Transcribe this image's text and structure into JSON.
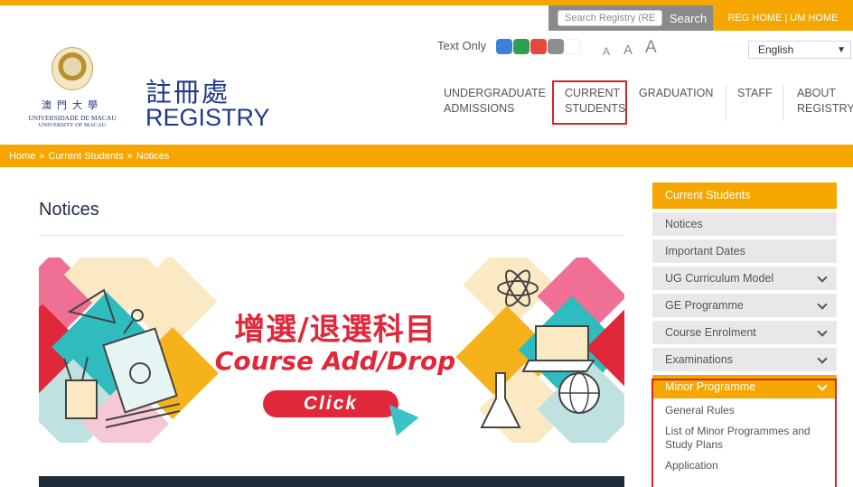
{
  "utility": {
    "search_placeholder": "Search Registry (REG)",
    "search_label": "Search",
    "reg_home": "REG HOME",
    "separator": "|",
    "um_home": "UM HOME"
  },
  "logo": {
    "university_cn": "澳門大學",
    "university_pt": "UNIVERSIDADE DE MACAU",
    "university_en": "UNIVERSITY OF MACAU"
  },
  "site": {
    "name_cn": "註冊處",
    "name_en": "REGISTRY"
  },
  "accessibility": {
    "text_only": "Text Only",
    "font_sizes": [
      "A",
      "A",
      "A"
    ],
    "swatch_colors": [
      "#3b82d6",
      "#2e9e4f",
      "#e8483b",
      "#8e8e8e",
      "#ffffff"
    ]
  },
  "language": {
    "selected": "English",
    "arrow": "▼"
  },
  "nav": {
    "items": [
      {
        "line1": "UNDERGRADUATE",
        "line2": "ADMISSIONS"
      },
      {
        "line1": "CURRENT",
        "line2": "STUDENTS"
      },
      {
        "line1": "GRADUATION",
        "line2": ""
      },
      {
        "line1": "STAFF",
        "line2": ""
      },
      {
        "line1": "ABOUT",
        "line2": "REGISTRY"
      }
    ]
  },
  "breadcrumb": {
    "home": "Home",
    "sep": "»",
    "section": "Current Students",
    "page": "Notices"
  },
  "main": {
    "title": "Notices",
    "banner": {
      "title_cn": "增選/退選科目",
      "title_en": "Course Add/Drop",
      "button": "Click"
    }
  },
  "sidebar": {
    "heading": "Current Students",
    "items": [
      {
        "label": "Notices"
      },
      {
        "label": "Important Dates"
      },
      {
        "label": "UG Curriculum Model"
      },
      {
        "label": "GE Programme"
      },
      {
        "label": "Course Enrolment"
      },
      {
        "label": "Examinations"
      }
    ],
    "active": "Minor Programme",
    "sub_items": [
      "General Rules",
      "List of Minor Programmes and Study Plans",
      "Application"
    ]
  },
  "colors": {
    "accent": "#f5a700",
    "brand_blue": "#1f3a8a",
    "highlight_red": "#d7232d",
    "banner_red": "#e0283a"
  }
}
